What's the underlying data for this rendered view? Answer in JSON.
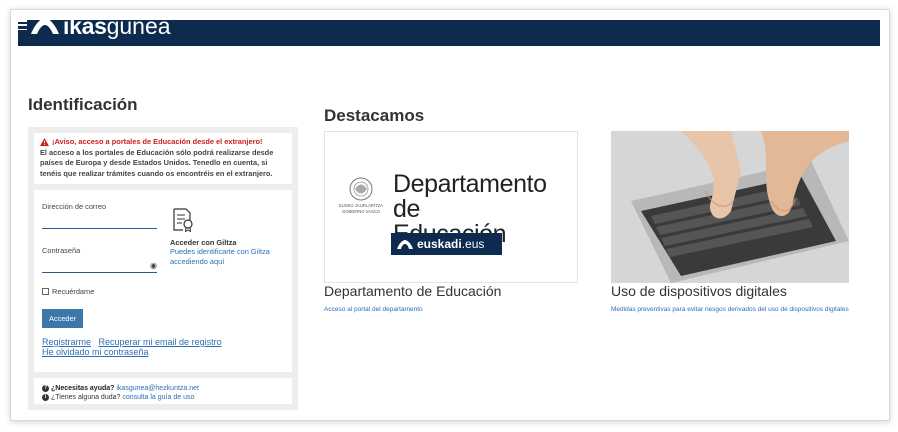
{
  "header": {
    "menu_icon": "hamburger-icon",
    "logo_ikas": "ikas",
    "logo_gunea": "gunea",
    "brand_color": "#0d2a4f"
  },
  "identificacion": {
    "title": "Identificación",
    "warning_title": "¡Aviso, acceso a portales de Educación desde el extranjero!",
    "warning_body": "El acceso a los portales de Educación sólo podrá realizarse desde países de Europa y desde Estados Unidos. Tenedlo en cuenta, si tenéis que realizar trámites cuando os encontréis en el extranjero.",
    "email_label": "Dirección de correo",
    "password_label": "Contraseña",
    "giltza_title": "Acceder con Giltza",
    "giltza_link": "Puedes identificarte con Giltza accediendo aquí",
    "remember_label": "Recuérdame",
    "login_button": "Acceder",
    "register_link": "Registrarme",
    "recover_email_link": "Recuperar mi email de registro",
    "forgot_password_link": "He olvidado mi contraseña",
    "help_question": "¿Necesitas ayuda?",
    "help_email": "ikasgunea@hezkuntza.net",
    "doubt_question": "¿Tienes alguna duda?",
    "doubt_link": "consulta la guía de uso"
  },
  "destacamos": {
    "title": "Destacamos",
    "card1": {
      "seal_line1": "EUSKO JAURLARITZA",
      "seal_line2": "GOBIERNO VASCO",
      "image_text_line1": "Departamento de",
      "image_text_line2": "Educación",
      "euskadi_bold": "euskadi",
      "euskadi_rest": ".eus",
      "title": "Departamento de Educación",
      "subtitle": "Acceso al portal del departamento"
    },
    "card2": {
      "title": "Uso de dispositivos digitales",
      "subtitle": "Medidas preventivas para evitar riesgos derivados del uso de dispositivos digitales"
    }
  },
  "colors": {
    "link": "#2c6fb5",
    "warning": "#c81f1f",
    "button": "#3b78a9"
  }
}
